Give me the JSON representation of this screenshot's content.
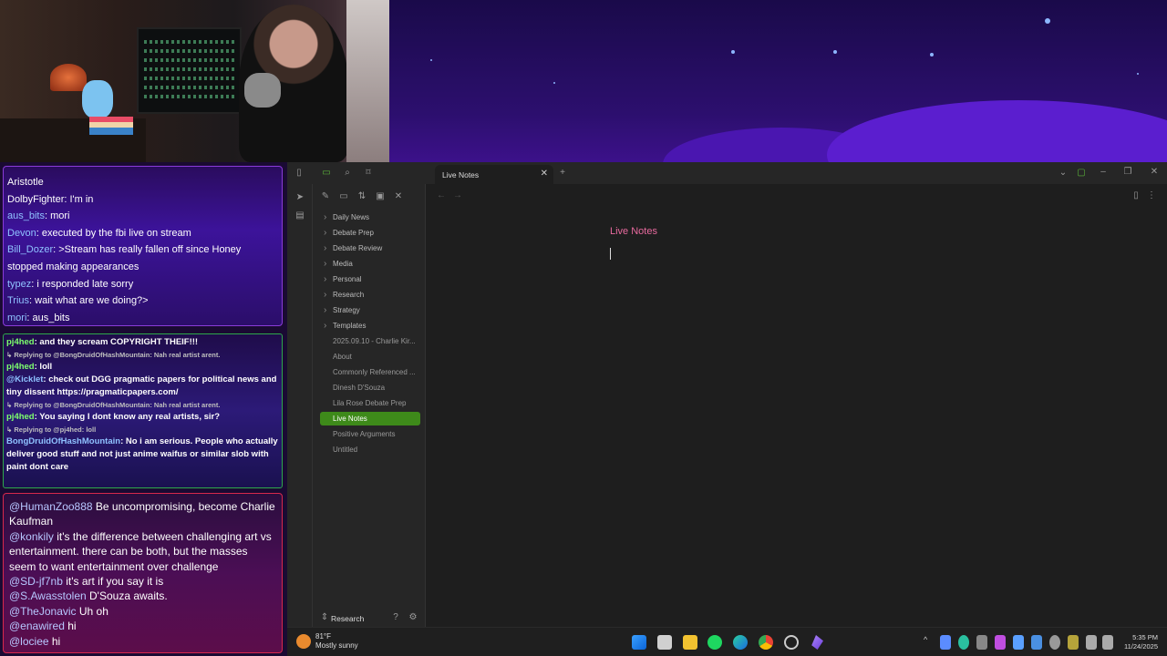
{
  "chat_top": [
    {
      "user": "Aristotle",
      "color": "#ffffff",
      "text": ""
    },
    {
      "user": "DolbyFighter",
      "color": "#ffffff",
      "text": "I'm in"
    },
    {
      "user": "aus_bits",
      "color": "#8fc2ff",
      "text": "mori"
    },
    {
      "user": "Devon",
      "color": "#8fc2ff",
      "text": "executed by the fbi live on stream"
    },
    {
      "user": "Bill_Dozer",
      "color": "#8fc2ff",
      "text": ">Stream has really fallen off since Honey stopped making appearances"
    },
    {
      "user": "typez",
      "color": "#8fc2ff",
      "text": "i responded late sorry"
    },
    {
      "user": "Trius",
      "color": "#8fc2ff",
      "text": "wait what are we doing?>"
    },
    {
      "user": "mori",
      "color": "#8fc2ff",
      "text": "aus_bits"
    }
  ],
  "chat_mid": [
    {
      "user": "pj4hed",
      "color": "#7dff6e",
      "text": "and they scream COPYRIGHT THEIF!!!",
      "reply": "Replying to @BongDruidOfHashMountain: Nah real artist arent."
    },
    {
      "user": "pj4hed",
      "color": "#7dff6e",
      "text": "loll",
      "reply": ""
    },
    {
      "user": "@Kicklet",
      "color": "#8fc2ff",
      "text": "check out DGG pragmatic papers for political news and tiny dissent https://pragmaticpapers.com/",
      "reply": "Replying to @BongDruidOfHashMountain: Nah real artist arent."
    },
    {
      "user": "pj4hed",
      "color": "#7dff6e",
      "text": "You saying I dont know any real artists, sir?",
      "reply": "Replying to @pj4hed: loll"
    },
    {
      "user": "BongDruidOfHashMountain",
      "color": "#8fc2ff",
      "text": "No i am serious. People who actually deliver good stuff and not just anime waifus or similar slob with paint dont care",
      "reply": ""
    }
  ],
  "chat_bottom": [
    {
      "user": "@HumanZoo888",
      "text": "Be uncompromising, become Charlie Kaufman"
    },
    {
      "user": "@konkily",
      "text": "it's the difference between challenging art vs entertainment. there can be both, but the masses seem to want entertainment over challenge"
    },
    {
      "user": "@SD-jf7nb",
      "text": "it's art if you say it is"
    },
    {
      "user": "@S.Awasstolen",
      "text": "D'Souza awaits."
    },
    {
      "user": "@TheJonavic",
      "text": "Uh oh"
    },
    {
      "user": "@enawired",
      "text": "hi"
    },
    {
      "user": "@lociee",
      "text": "hi"
    }
  ],
  "app": {
    "tab_title": "Live Notes",
    "folders": [
      "Daily News",
      "Debate Prep",
      "Debate Review",
      "Media",
      "Personal",
      "Research",
      "Strategy",
      "Templates"
    ],
    "files": [
      "2025.09.10 - Charlie Kir...",
      "About",
      "Commonly Referenced ...",
      "Dinesh D'Souza",
      "Lila Rose Debate Prep",
      "Live Notes",
      "Positive Arguments",
      "Untitled"
    ],
    "active_file": "Live Notes",
    "vault_name": "Research",
    "note_title": "Live Notes"
  },
  "taskbar": {
    "temperature": "81°F",
    "weather": "Mostly sunny",
    "time": "5:35 PM",
    "date": "11/24/2025"
  }
}
